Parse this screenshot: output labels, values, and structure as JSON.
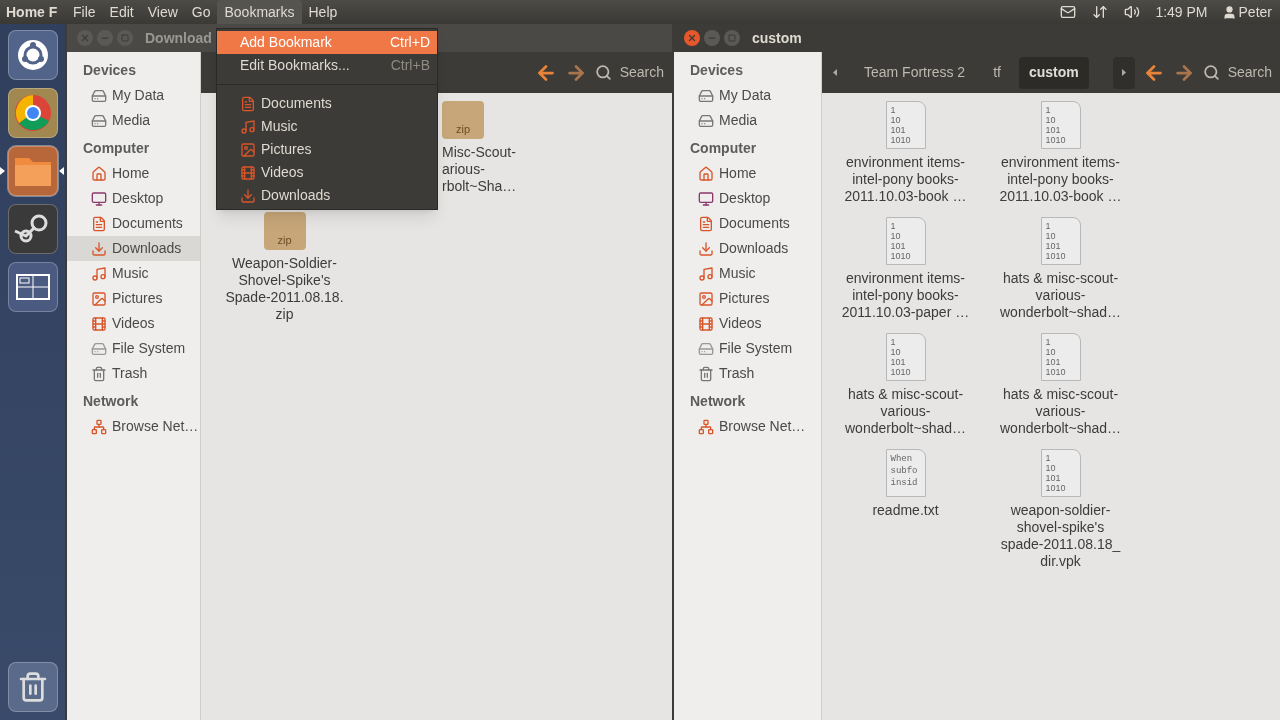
{
  "top_panel": {
    "app_title": "Home F",
    "menus": [
      {
        "label": "File",
        "selected": false
      },
      {
        "label": "Edit",
        "selected": false
      },
      {
        "label": "View",
        "selected": false
      },
      {
        "label": "Go",
        "selected": false
      },
      {
        "label": "Bookmarks",
        "selected": true
      },
      {
        "label": "Help",
        "selected": false
      }
    ],
    "time": "1:49 PM",
    "user": "Peter"
  },
  "launcher": {
    "items": [
      {
        "kind": "dash",
        "running": false
      },
      {
        "kind": "browser",
        "running": false
      },
      {
        "kind": "files",
        "running": true
      },
      {
        "kind": "steam",
        "running": false
      },
      {
        "kind": "workspaces",
        "running": false
      }
    ],
    "trash": {
      "kind": "trash",
      "running": false
    }
  },
  "bookmarks_menu": {
    "actions": [
      {
        "label": "Add Bookmark",
        "shortcut": "Ctrl+D",
        "selected": true
      },
      {
        "label": "Edit Bookmarks...",
        "shortcut": "Ctrl+B",
        "selected": false
      }
    ],
    "places": [
      {
        "label": "Documents",
        "kind": "documents"
      },
      {
        "label": "Music",
        "kind": "music"
      },
      {
        "label": "Pictures",
        "kind": "pictures"
      },
      {
        "label": "Videos",
        "kind": "videos"
      },
      {
        "label": "Downloads",
        "kind": "downloads"
      }
    ]
  },
  "windows": [
    {
      "title": "Download",
      "focused": false,
      "search": "Search",
      "sidebar": [
        {
          "heading": "Devices",
          "items": [
            {
              "label": "My Data",
              "kind": "drive",
              "selected": false
            },
            {
              "label": "Media",
              "kind": "drive",
              "selected": false
            }
          ]
        },
        {
          "heading": "Computer",
          "items": [
            {
              "label": "Home",
              "kind": "home",
              "selected": false
            },
            {
              "label": "Desktop",
              "kind": "desktop",
              "selected": false
            },
            {
              "label": "Documents",
              "kind": "documents",
              "selected": false
            },
            {
              "label": "Downloads",
              "kind": "downloads",
              "selected": true
            },
            {
              "label": "Music",
              "kind": "music",
              "selected": false
            },
            {
              "label": "Pictures",
              "kind": "pictures",
              "selected": false
            },
            {
              "label": "Videos",
              "kind": "videos",
              "selected": false
            },
            {
              "label": "File System",
              "kind": "filesystem",
              "selected": false
            },
            {
              "label": "Trash",
              "kind": "trash",
              "selected": false
            }
          ]
        },
        {
          "heading": "Network",
          "items": [
            {
              "label": "Browse Net…",
              "kind": "network",
              "selected": false
            }
          ]
        }
      ],
      "files": [
        {
          "kind": "hidden"
        },
        {
          "kind": "zip",
          "badge": "zip",
          "name": "Misc-Scout-\narious-\nrbolt~Sha…",
          "cut_left": true
        },
        {
          "kind": "hidden"
        },
        {
          "kind": "zip",
          "badge": "zip",
          "name": "Weapon-Soldier-\nShovel-Spike's\nSpade-2011.08.18.\nzip",
          "cut_left": false
        }
      ]
    },
    {
      "title": "custom",
      "focused": true,
      "search": "Search",
      "path": [
        {
          "label": "Team Fortress 2",
          "selected": false
        },
        {
          "label": "tf",
          "selected": false
        },
        {
          "label": "custom",
          "selected": true
        }
      ],
      "sidebar": [
        {
          "heading": "Devices",
          "items": [
            {
              "label": "My Data",
              "kind": "drive",
              "selected": false
            },
            {
              "label": "Media",
              "kind": "drive",
              "selected": false
            }
          ]
        },
        {
          "heading": "Computer",
          "items": [
            {
              "label": "Home",
              "kind": "home",
              "selected": false
            },
            {
              "label": "Desktop",
              "kind": "desktop",
              "selected": false
            },
            {
              "label": "Documents",
              "kind": "documents",
              "selected": false
            },
            {
              "label": "Downloads",
              "kind": "downloads",
              "selected": false
            },
            {
              "label": "Music",
              "kind": "music",
              "selected": false
            },
            {
              "label": "Pictures",
              "kind": "pictures",
              "selected": false
            },
            {
              "label": "Videos",
              "kind": "videos",
              "selected": false
            },
            {
              "label": "File System",
              "kind": "filesystem",
              "selected": false
            },
            {
              "label": "Trash",
              "kind": "trash",
              "selected": false
            }
          ]
        },
        {
          "heading": "Network",
          "items": [
            {
              "label": "Browse Net…",
              "kind": "network",
              "selected": false
            }
          ]
        }
      ],
      "files": [
        {
          "kind": "binary",
          "thumb": [
            "1",
            "10",
            "101",
            "1010"
          ],
          "name": "environment items-\nintel-pony books-\n2011.10.03-book …",
          "cut_left": false
        },
        {
          "kind": "binary",
          "thumb": [
            "1",
            "10",
            "101",
            "1010"
          ],
          "name": "environment items-\nintel-pony books-\n2011.10.03-book …",
          "cut_left": false
        },
        {
          "kind": "binary",
          "thumb": [
            "1",
            "10",
            "101",
            "1010"
          ],
          "name": "environment items-\nintel-pony books-\n2011.10.03-paper …",
          "cut_left": false
        },
        {
          "kind": "binary",
          "thumb": [
            "1",
            "10",
            "101",
            "1010"
          ],
          "name": "hats & misc-scout-\nvarious-\nwonderbolt~shad…",
          "cut_left": false
        },
        {
          "kind": "binary",
          "thumb": [
            "1",
            "10",
            "101",
            "1010"
          ],
          "name": "hats & misc-scout-\nvarious-\nwonderbolt~shad…",
          "cut_left": false
        },
        {
          "kind": "binary",
          "thumb": [
            "1",
            "10",
            "101",
            "1010"
          ],
          "name": "hats & misc-scout-\nvarious-\nwonderbolt~shad…",
          "cut_left": false
        },
        {
          "kind": "text",
          "thumb": [
            "When",
            "subfo",
            "insid"
          ],
          "name": "readme.txt",
          "cut_left": false
        },
        {
          "kind": "binary",
          "thumb": [
            "1",
            "10",
            "101",
            "1010"
          ],
          "name": "weapon-soldier-\nshovel-spike's\nspade-2011.08.18_\ndir.vpk",
          "cut_left": false
        }
      ]
    }
  ]
}
